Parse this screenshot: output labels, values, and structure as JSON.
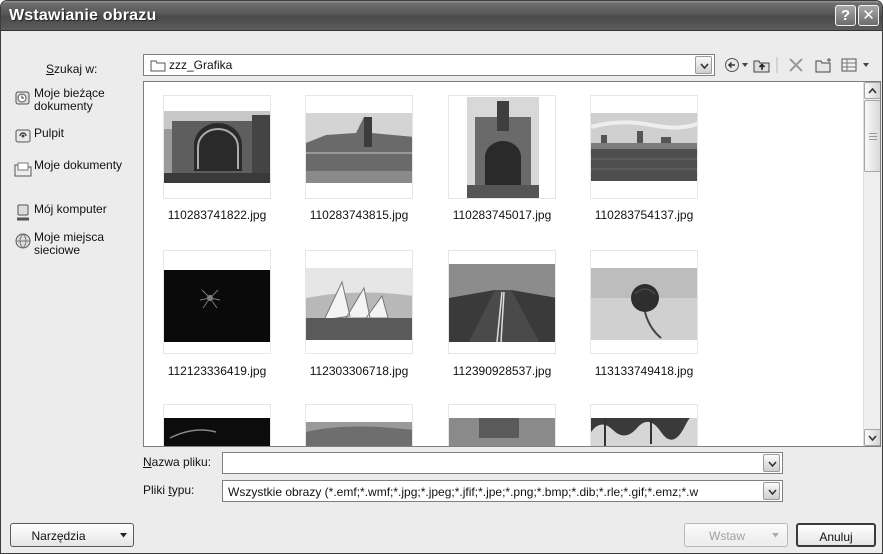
{
  "window": {
    "title": "Wstawianie obrazu",
    "help_glyph": "?",
    "close_glyph": "✕"
  },
  "lookin": {
    "label": "Szukaj w:",
    "value": "zzz_Grafika"
  },
  "toolbar": {
    "icons": [
      "back-icon",
      "up-folder-icon",
      "delete-icon",
      "new-folder-icon",
      "views-icon"
    ]
  },
  "places": [
    {
      "label": "Moje bieżące dokumenty",
      "icon": "recent-documents-icon"
    },
    {
      "label": "Pulpit",
      "icon": "desktop-icon"
    },
    {
      "label": "Moje dokumenty",
      "icon": "my-documents-icon"
    },
    {
      "label": "Mój komputer",
      "icon": "my-computer-icon"
    },
    {
      "label": "Moje miejsca sieciowe",
      "icon": "network-places-icon"
    }
  ],
  "files": [
    {
      "name": "110283741822.jpg"
    },
    {
      "name": "110283743815.jpg"
    },
    {
      "name": "110283745017.jpg"
    },
    {
      "name": "110283754137.jpg"
    },
    {
      "name": "112123336419.jpg"
    },
    {
      "name": "112303306718.jpg"
    },
    {
      "name": "112390928537.jpg"
    },
    {
      "name": "113133749418.jpg"
    }
  ],
  "filename": {
    "label": "Nazwa pliku:",
    "value": ""
  },
  "filetype": {
    "label": "Pliki typu:",
    "value": "Wszystkie obrazy (*.emf;*.wmf;*.jpg;*.jpeg;*.jfif;*.jpe;*.png;*.bmp;*.dib;*.rle;*.gif;*.emz;*.w"
  },
  "buttons": {
    "tools": "Narzędzia",
    "insert": "Wstaw",
    "cancel": "Anuluj"
  }
}
